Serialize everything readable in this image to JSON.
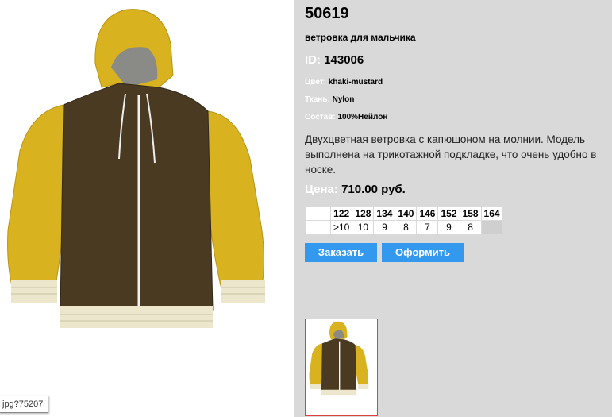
{
  "product": {
    "article": "50619",
    "subtitle": "ветровка для мальчика",
    "id_label": "ID:",
    "id_value": "143006",
    "props": [
      {
        "label": "Цвет:",
        "value": "khaki-mustard"
      },
      {
        "label": "Ткань:",
        "value": "Nylon"
      },
      {
        "label": "Состав:",
        "value": "100%Нейлон"
      }
    ],
    "description": "Двухцветная ветровка с капюшоном на молнии. Модель выполнена на трикотажной подкладке, что очень удобно в носке.",
    "price_label": "Цена:",
    "price_value": "710.00 руб."
  },
  "sizes": {
    "headers": [
      "122",
      "128",
      "134",
      "140",
      "146",
      "152",
      "158",
      "164"
    ],
    "stock": [
      ">10",
      "10",
      "9",
      "8",
      "7",
      "9",
      "8",
      ""
    ]
  },
  "buttons": {
    "order": "Заказать",
    "checkout": "Оформить"
  },
  "tooltip": {
    "text": "jpg?75207"
  },
  "colors": {
    "panel_bg": "#d9d9d9",
    "button_bg": "#3399ee",
    "thumb_border": "#e04040",
    "jacket_body": "#4a3a22",
    "jacket_sleeves": "#d8b21f",
    "jacket_cuffs": "#ece6cc"
  }
}
